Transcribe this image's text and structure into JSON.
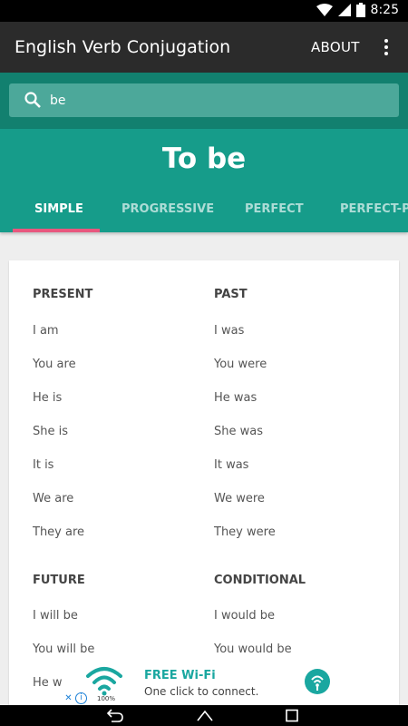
{
  "status_bar": {
    "time": "8:25"
  },
  "app_bar": {
    "title": "English Verb Conjugation",
    "about": "ABOUT"
  },
  "search": {
    "value": "be"
  },
  "verb": {
    "title": "To be"
  },
  "tabs": [
    {
      "label": "SIMPLE"
    },
    {
      "label": "PROGRESSIVE"
    },
    {
      "label": "PERFECT"
    },
    {
      "label": "PERFECT-PR"
    }
  ],
  "sections": {
    "present": {
      "title": "PRESENT",
      "forms": [
        "I am",
        "You are",
        "He is",
        "She is",
        "It is",
        "We are",
        "They are"
      ]
    },
    "past": {
      "title": "PAST",
      "forms": [
        "I was",
        "You were",
        "He was",
        "She was",
        "It was",
        "We were",
        "They were"
      ]
    },
    "future": {
      "title": "FUTURE",
      "forms": [
        "I will be",
        "You will be",
        "He wi"
      ]
    },
    "conditional": {
      "title": "CONDITIONAL",
      "forms": [
        "I would be",
        "You would be"
      ]
    }
  },
  "ad": {
    "title": "FREE Wi-Fi",
    "subtitle": "One click to connect.",
    "percent": "100%",
    "close": "✕",
    "info": "i"
  },
  "colors": {
    "primary": "#169c8a",
    "primary_dark": "#12806f",
    "accent": "#e8577e",
    "app_bar": "#2b2b2b"
  }
}
